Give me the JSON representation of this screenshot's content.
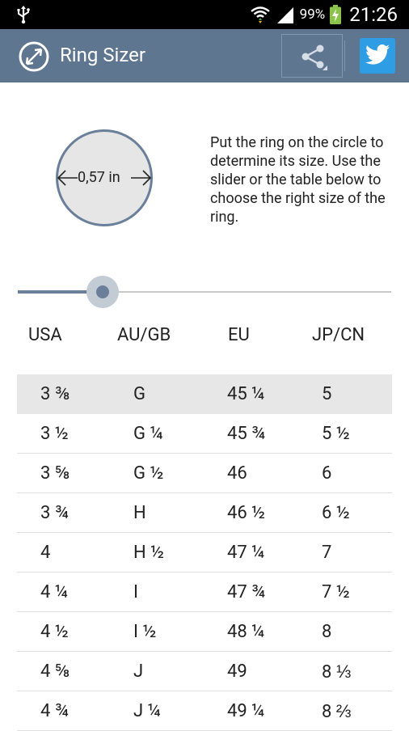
{
  "status_bar": {
    "battery_percent": "99%",
    "time": "21:26",
    "icons": [
      "usb-icon",
      "wifi-icon",
      "signal-icon",
      "battery-charging-icon"
    ]
  },
  "action_bar": {
    "title": "Ring Sizer",
    "app_icon": "ring-diameter-icon",
    "share_icon": "share-icon",
    "twitter_icon": "twitter-icon",
    "colors": {
      "background": "#5f7691",
      "twitter": "#2f9de4"
    }
  },
  "sizer": {
    "diameter_label": "0,57 in",
    "instructions": "Put the ring on the circle to determine its size. Use the slider or the table below to choose the right size of the ring."
  },
  "slider": {
    "value_fraction": 0.23
  },
  "table": {
    "headers": [
      "USA",
      "AU/GB",
      "EU",
      "JP/CN"
    ],
    "selected_index": 0,
    "rows": [
      [
        "3 ⅜",
        "G",
        "45 ¼",
        "5"
      ],
      [
        "3 ½",
        "G ¼",
        "45 ¾",
        "5 ½"
      ],
      [
        "3 ⅝",
        "G ½",
        "46",
        "6"
      ],
      [
        "3 ¾",
        "H",
        "46 ½",
        "6 ½"
      ],
      [
        "4",
        "H ½",
        "47 ¼",
        "7"
      ],
      [
        "4 ¼",
        "I",
        "47 ¾",
        "7 ½"
      ],
      [
        "4 ½",
        "I ½",
        "48 ¼",
        "8"
      ],
      [
        "4 ⅝",
        "J",
        "49",
        "8 ⅓"
      ],
      [
        "4 ¾",
        "J ¼",
        "49 ¼",
        "8 ⅔"
      ]
    ]
  }
}
